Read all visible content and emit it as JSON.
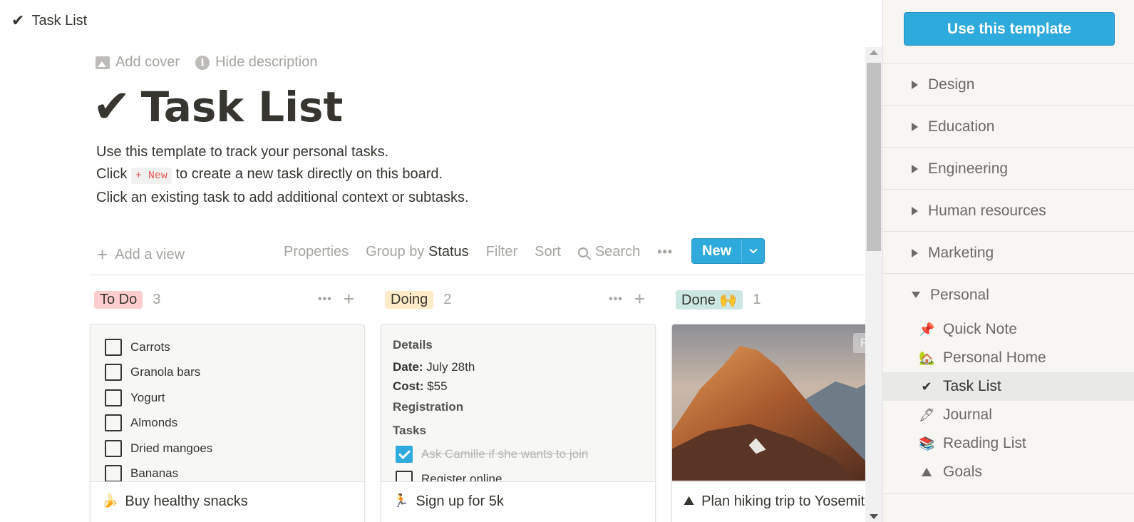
{
  "topbar": {
    "icon": "check-icon",
    "title": "Task List"
  },
  "page": {
    "add_cover": "Add cover",
    "hide_description": "Hide description",
    "title": "Task List",
    "desc_line1": "Use this template to track your personal tasks.",
    "desc_line2_pre": "Click ",
    "desc_code": "+ New",
    "desc_line2_post": " to create a new task directly on this board.",
    "desc_line3": "Click an existing task to add additional context or subtasks."
  },
  "toolbar": {
    "add_view": "Add a view",
    "properties": "Properties",
    "group_by": "Group by",
    "group_value": "Status",
    "filter": "Filter",
    "sort": "Sort",
    "search": "Search",
    "more": "•••",
    "new": "New"
  },
  "board": {
    "columns": [
      {
        "name": "To Do",
        "count": "3",
        "color": "#ffcccf"
      },
      {
        "name": "Doing",
        "count": "2",
        "color": "#fdecc8"
      },
      {
        "name": "Done 🙌",
        "count": "1",
        "color": "#cce7e1"
      }
    ],
    "todo_card": {
      "items": [
        "Carrots",
        "Granola bars",
        "Yogurt",
        "Almonds",
        "Dried mangoes",
        "Bananas"
      ],
      "emoji": "🍌",
      "title": "Buy healthy snacks"
    },
    "doing_card": {
      "details_header": "Details",
      "date_label": "Date:",
      "date_value": " July 28th",
      "cost_label": "Cost:",
      "cost_value": " $55",
      "registration": "Registration",
      "tasks": "Tasks",
      "task1": "Ask Camille if she wants to join",
      "task2": "Register online",
      "emoji": "🏃",
      "title": "Sign up for 5k"
    },
    "done_card": {
      "reposition": "Rep",
      "emoji": "⛰",
      "title": "Plan hiking trip to Yosemite"
    }
  },
  "sidebar": {
    "use_template": "Use this template",
    "categories": [
      "Design",
      "Education",
      "Engineering",
      "Human resources",
      "Marketing"
    ],
    "open_category": "Personal",
    "items": [
      {
        "emoji": "📌",
        "label": "Quick Note"
      },
      {
        "emoji": "🏡",
        "label": "Personal Home"
      },
      {
        "emoji": "✔",
        "label": "Task List"
      },
      {
        "emoji": "🖋",
        "label": "Journal"
      },
      {
        "emoji": "📚",
        "label": "Reading List"
      },
      {
        "emoji": "⛰",
        "label": "Goals"
      }
    ]
  }
}
